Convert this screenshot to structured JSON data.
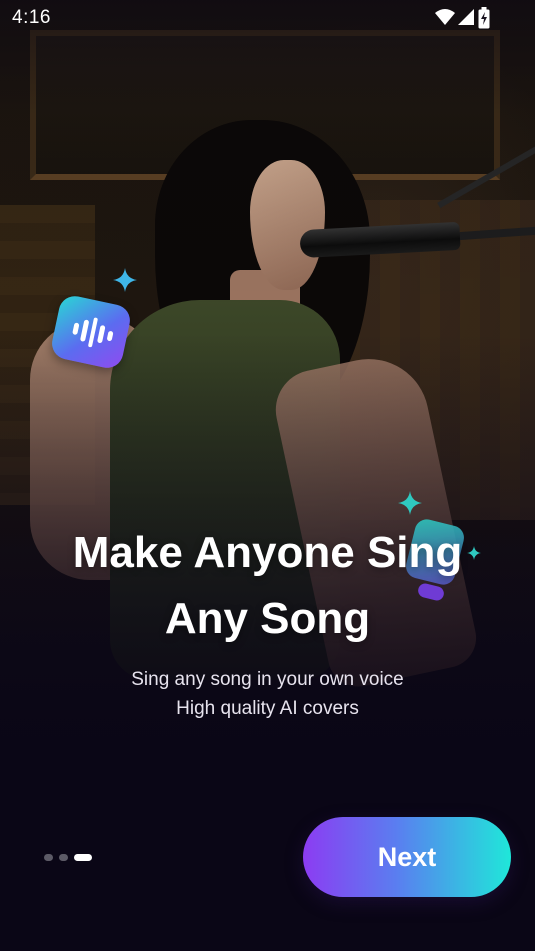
{
  "status_bar": {
    "time": "4:16",
    "icons": [
      "wifi-icon",
      "cell-signal-icon",
      "battery-charging-icon"
    ]
  },
  "onboarding": {
    "headline_line1": "Make Anyone Sing",
    "headline_line2": "Any Song",
    "subtitle_line1": "Sing any song in your own voice",
    "subtitle_line2": "High quality AI covers",
    "page_count": 3,
    "active_page": 3,
    "next_label": "Next"
  },
  "colors": {
    "button_gradient_start": "#8c3cf2",
    "button_gradient_end": "#1fe7d9",
    "dot_active": "#ffffff",
    "dot_inactive": "#5c5a66"
  }
}
